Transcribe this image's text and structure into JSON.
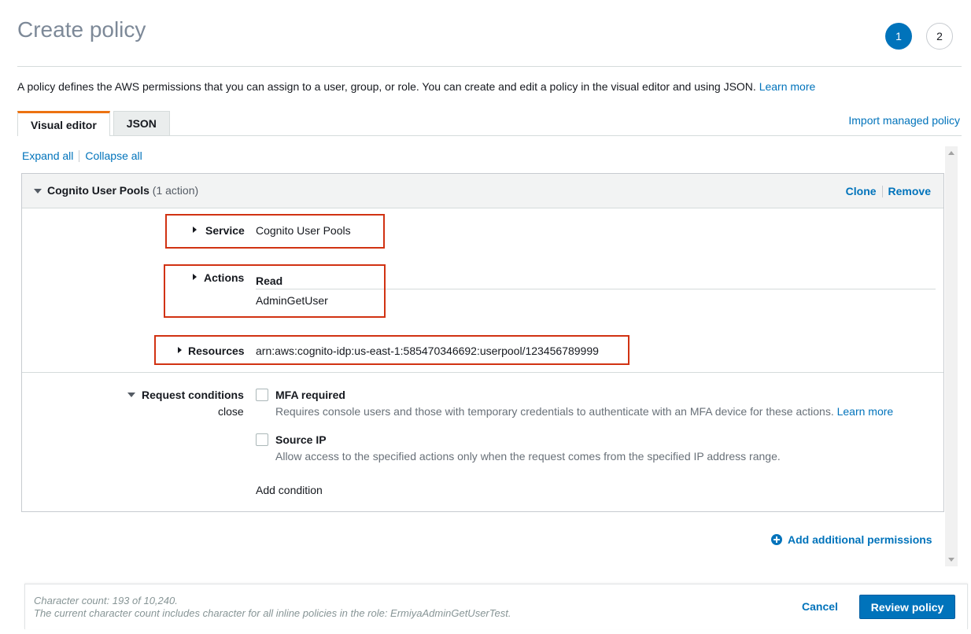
{
  "page": {
    "title": "Create policy",
    "steps": [
      "1",
      "2"
    ],
    "intro_text": "A policy defines the AWS permissions that you can assign to a user, group, or role. You can create and edit a policy in the visual editor and using JSON.",
    "intro_link": "Learn more"
  },
  "tabs": [
    {
      "label": "Visual editor",
      "active": true
    },
    {
      "label": "JSON",
      "active": false
    }
  ],
  "import_link": "Import managed policy",
  "toggles": {
    "expand": "Expand all",
    "collapse": "Collapse all"
  },
  "panel": {
    "title": "Cognito User Pools",
    "subtitle": "(1 action)",
    "clone": "Clone",
    "remove": "Remove",
    "service": {
      "label": "Service",
      "value": "Cognito User Pools"
    },
    "actions": {
      "label": "Actions",
      "group": "Read",
      "value": "AdminGetUser"
    },
    "resources": {
      "label": "Resources",
      "value": "arn:aws:cognito-idp:us-east-1:585470346692:userpool/123456789999"
    },
    "request_conditions": {
      "label": "Request conditions",
      "close": "close",
      "conditions": [
        {
          "title": "MFA required",
          "desc": "Requires console users and those with temporary credentials to authenticate with an MFA device for these actions.",
          "link": "Learn more",
          "checked": false
        },
        {
          "title": "Source IP",
          "desc": "Allow access to the specified actions only when the request comes from the specified IP address range.",
          "checked": false
        }
      ],
      "add_condition": "Add condition"
    }
  },
  "add_permissions": "Add additional permissions",
  "footer": {
    "char_count": "Character count: 193 of 10,240.",
    "note": "The current character count includes character for all inline policies in the role: ErmiyaAdminGetUserTest.",
    "cancel": "Cancel",
    "review": "Review policy"
  },
  "colors": {
    "accent": "#0073bb",
    "tab_accent": "#ec7211",
    "highlight": "#d13212"
  }
}
